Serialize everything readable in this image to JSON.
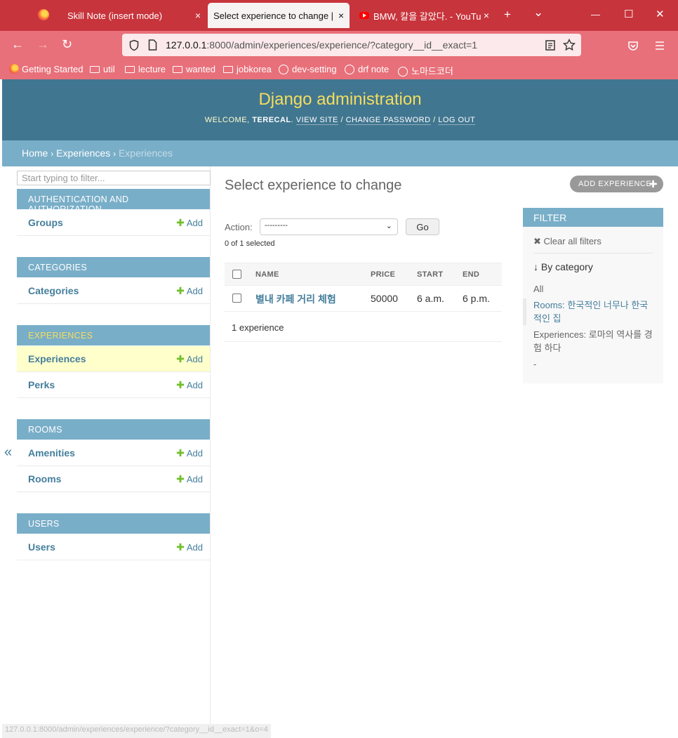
{
  "browser": {
    "tabs": [
      {
        "title": "Skill Note (insert mode)",
        "close": "×"
      },
      {
        "title": "Select experience to change | D",
        "close": "×"
      },
      {
        "title": "BMW, 칼을 갈았다. - YouTu",
        "close": "×"
      }
    ],
    "new_tab": "+",
    "tab_list": "⌄",
    "window_controls": {
      "minimize": "—",
      "maximize": "☐",
      "close": "✕"
    },
    "nav": {
      "back": "←",
      "forward": "→",
      "reload": "↻"
    },
    "url_host": "127.0.0.1",
    "url_rest": ":8000/admin/experiences/experience/?category__id__exact=1",
    "bookmarks": [
      "Getting Started",
      "util",
      "lecture",
      "wanted",
      "jobkorea",
      "dev-setting",
      "drf note",
      "노마드코더"
    ]
  },
  "header": {
    "brand": "Django administration",
    "welcome": "WELCOME,",
    "username": "TERECAL",
    "view_site": "VIEW SITE",
    "change_password": "CHANGE PASSWORD",
    "log_out": "LOG OUT",
    "sep": "/"
  },
  "breadcrumbs": {
    "home": "Home",
    "app": "Experiences",
    "current": "Experiences",
    "sep": "›"
  },
  "sidebar": {
    "filter_placeholder": "Start typing to filter...",
    "collapse": "«",
    "add_label": "Add",
    "modules": [
      {
        "caption": "AUTHENTICATION AND AUTHORIZATION",
        "models": [
          {
            "name": "Groups"
          }
        ]
      },
      {
        "caption": "CATEGORIES",
        "models": [
          {
            "name": "Categories"
          }
        ]
      },
      {
        "caption": "EXPERIENCES",
        "models": [
          {
            "name": "Experiences"
          },
          {
            "name": "Perks"
          }
        ]
      },
      {
        "caption": "ROOMS",
        "models": [
          {
            "name": "Amenities"
          },
          {
            "name": "Rooms"
          }
        ]
      },
      {
        "caption": "USERS",
        "models": [
          {
            "name": "Users"
          }
        ]
      }
    ]
  },
  "main": {
    "title": "Select experience to change",
    "add_button": "ADD EXPERIENCE",
    "action_label": "Action:",
    "action_value": "---------",
    "go": "Go",
    "selected_count": "0 of 1 selected",
    "columns": [
      "NAME",
      "PRICE",
      "START",
      "END"
    ],
    "rows": [
      {
        "name": "별내 카페 거리 체험",
        "price": "50000",
        "start": "6 a.m.",
        "end": "6 p.m."
      }
    ],
    "paginator": "1 experience"
  },
  "filter": {
    "title": "FILTER",
    "clear": "Clear all filters",
    "by": "↓ By category",
    "options": {
      "all": "All",
      "rooms_prefix": "Rooms: ",
      "rooms_value": "한국적인 너무나 한국적인 집",
      "exp_prefix": "Experiences: ",
      "exp_value": "로마의 역사를 경험 하다",
      "dash": "-"
    }
  },
  "status_bar": "127.0.0.1:8000/admin/experiences/experience/?category__id__exact=1&o=4",
  "colors": {
    "header": "#417690",
    "module": "#79aec8",
    "link": "#447e9b",
    "brand": "#f5dd5d",
    "tabbar": "#c8343c",
    "toolbar": "#e8707a"
  }
}
